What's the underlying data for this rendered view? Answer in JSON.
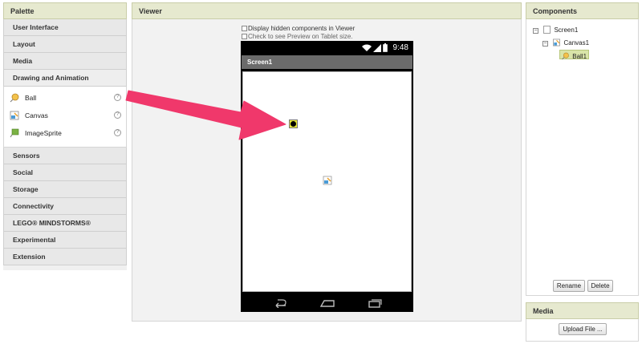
{
  "palette": {
    "title": "Palette",
    "categories_top": [
      "User Interface",
      "Layout",
      "Media",
      "Drawing and Animation"
    ],
    "items": [
      {
        "label": "Ball",
        "icon": "ball-icon",
        "help": "?"
      },
      {
        "label": "Canvas",
        "icon": "canvas-icon",
        "help": "?"
      },
      {
        "label": "ImageSprite",
        "icon": "imagesprite-icon",
        "help": "?"
      }
    ],
    "categories_bottom": [
      "Sensors",
      "Social",
      "Storage",
      "Connectivity",
      "LEGO® MINDSTORMS®",
      "Experimental",
      "Extension"
    ]
  },
  "viewer": {
    "title": "Viewer",
    "display_hidden": "Display hidden components in Viewer",
    "tablet_preview": "Check to see Preview on Tablet size.",
    "phone": {
      "time": "9:48",
      "screen_title": "Screen1"
    }
  },
  "components": {
    "title": "Components",
    "tree": {
      "screen": "Screen1",
      "canvas": "Canvas1",
      "ball": "Ball1"
    },
    "rename_label": "Rename",
    "delete_label": "Delete"
  },
  "media": {
    "title": "Media",
    "upload_label": "Upload File ..."
  },
  "colors": {
    "header_bg": "#e6e9cf",
    "arrow": "#f0386b",
    "selection": "#d9e4a8"
  }
}
